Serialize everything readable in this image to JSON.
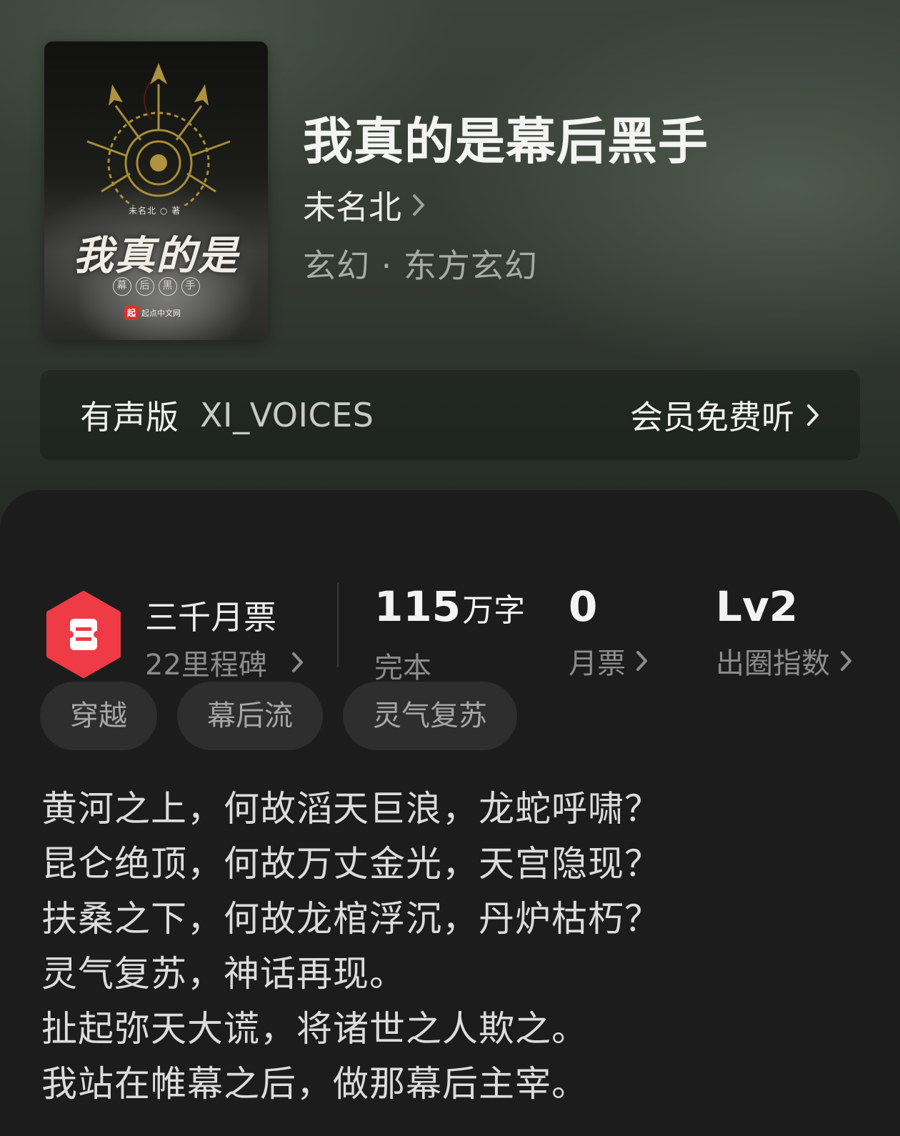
{
  "book": {
    "title": "我真的是幕后黑手",
    "author": "未名北",
    "genre": "玄幻 · 东方玄幻",
    "cover": {
      "title": "我真的是",
      "author_line": "未名北 ○ 著",
      "subtitle_chars": [
        "幕",
        "后",
        "黑",
        "手"
      ],
      "publisher": "起点中文网",
      "publisher_logo": "起"
    }
  },
  "audio": {
    "label": "有声版",
    "brand": "XI_VOICES",
    "action": "会员免费听"
  },
  "stats": {
    "rank": {
      "title": "三千月票",
      "subtitle": "22里程碑"
    },
    "words": {
      "value": "115",
      "unit": "万字",
      "label": "完本"
    },
    "monthly_tickets": {
      "value": "0",
      "label": "月票"
    },
    "circle_index": {
      "value": "Lv2",
      "label": "出圈指数"
    }
  },
  "tags": [
    "穿越",
    "幕后流",
    "灵气复苏"
  ],
  "synopsis": [
    "黄河之上，何故滔天巨浪，龙蛇呼啸？",
    "昆仑绝顶，何故万丈金光，天宫隐现？",
    "扶桑之下，何故龙棺浮沉，丹炉枯朽？",
    "灵气复苏，神话再现。",
    "扯起弥天大谎，将诸世之人欺之。",
    "我站在帷幕之后，做那幕后主宰。"
  ],
  "colors": {
    "badge_red": "#ef3b45",
    "panel_bg": "#1c1c1c",
    "tag_bg": "#2e2e2e"
  },
  "icons": {
    "chevron": "chevron-right-icon",
    "badge": "ticket-badge-icon"
  }
}
